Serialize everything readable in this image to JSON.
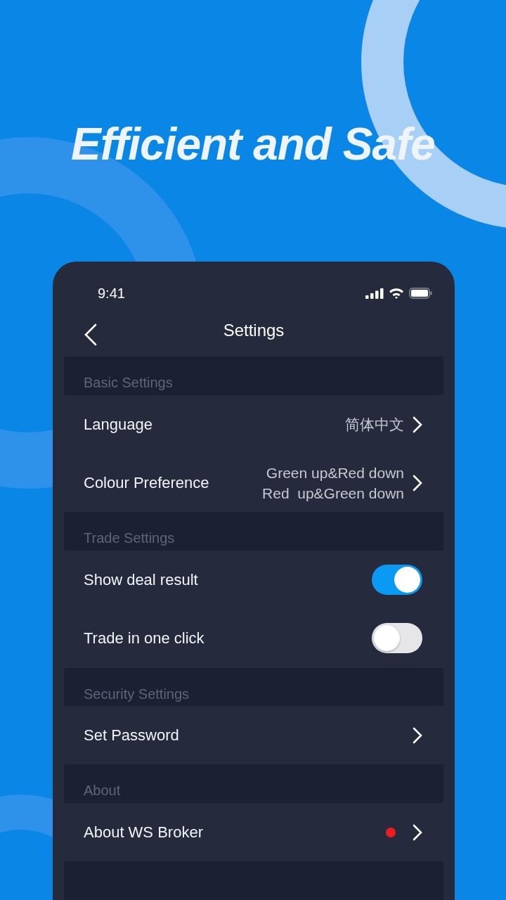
{
  "headline": "Efficient and Safe",
  "status_bar": {
    "time": "9:41"
  },
  "nav": {
    "title": "Settings"
  },
  "sections": [
    {
      "title": "Basic Settings",
      "rows": [
        {
          "kind": "link",
          "label": "Language",
          "values": [
            "简体中文"
          ],
          "badge": false
        },
        {
          "kind": "link",
          "label": "Colour Preference",
          "values": [
            "Green up&Red down",
            "Red  up&Green down"
          ],
          "badge": false
        }
      ]
    },
    {
      "title": "Trade Settings",
      "rows": [
        {
          "kind": "toggle",
          "label": "Show deal result",
          "on": true
        },
        {
          "kind": "toggle",
          "label": "Trade in one click",
          "on": false
        }
      ]
    },
    {
      "title": "Security Settings",
      "rows": [
        {
          "kind": "link",
          "label": "Set Password",
          "badge": false
        }
      ]
    },
    {
      "title": "About",
      "rows": [
        {
          "kind": "link",
          "label": "About WS Broker",
          "badge": true
        }
      ]
    }
  ]
}
